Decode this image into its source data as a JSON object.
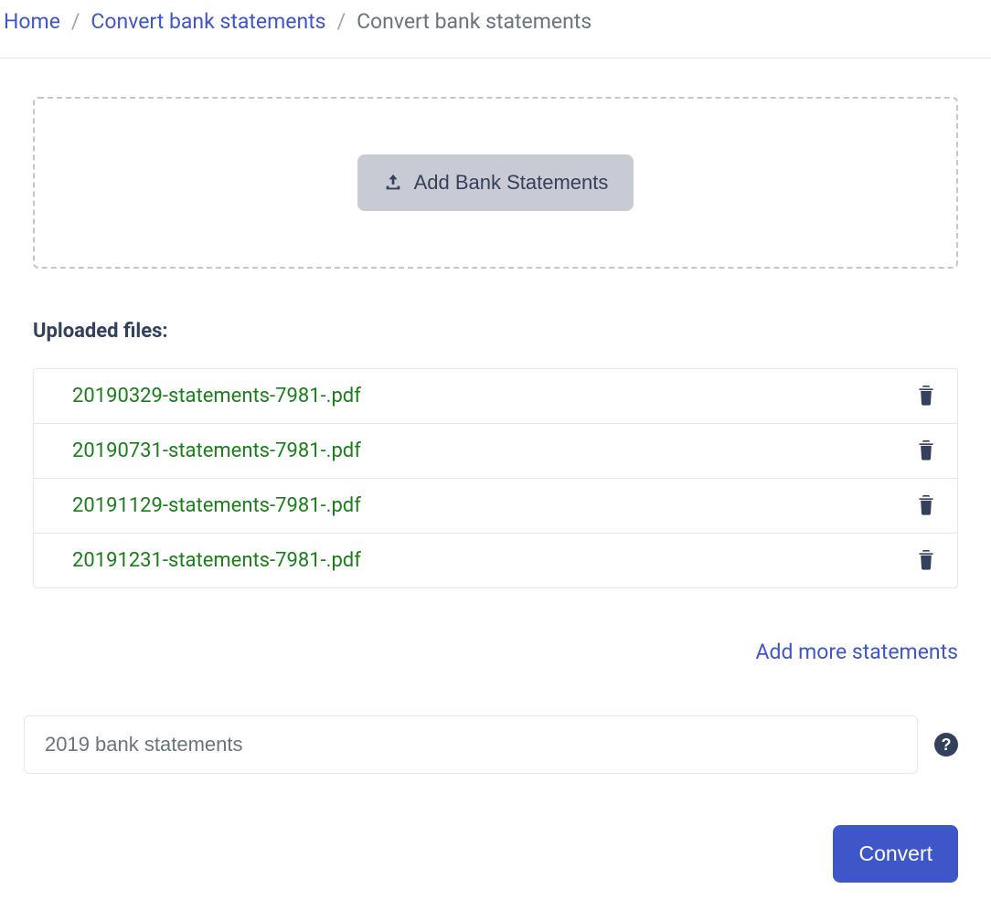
{
  "breadcrumb": {
    "home": "Home",
    "convert_link": "Convert bank statements",
    "current": "Convert bank statements"
  },
  "dropzone": {
    "add_button": "Add Bank Statements"
  },
  "uploaded": {
    "header": "Uploaded files:",
    "files": [
      {
        "name": "20190329-statements-7981-.pdf"
      },
      {
        "name": "20190731-statements-7981-.pdf"
      },
      {
        "name": "20191129-statements-7981-.pdf"
      },
      {
        "name": "20191231-statements-7981-.pdf"
      }
    ]
  },
  "add_more_link": "Add more statements",
  "name_input": {
    "value": "2019 bank statements"
  },
  "help_tooltip": "?",
  "convert_button": "Convert"
}
